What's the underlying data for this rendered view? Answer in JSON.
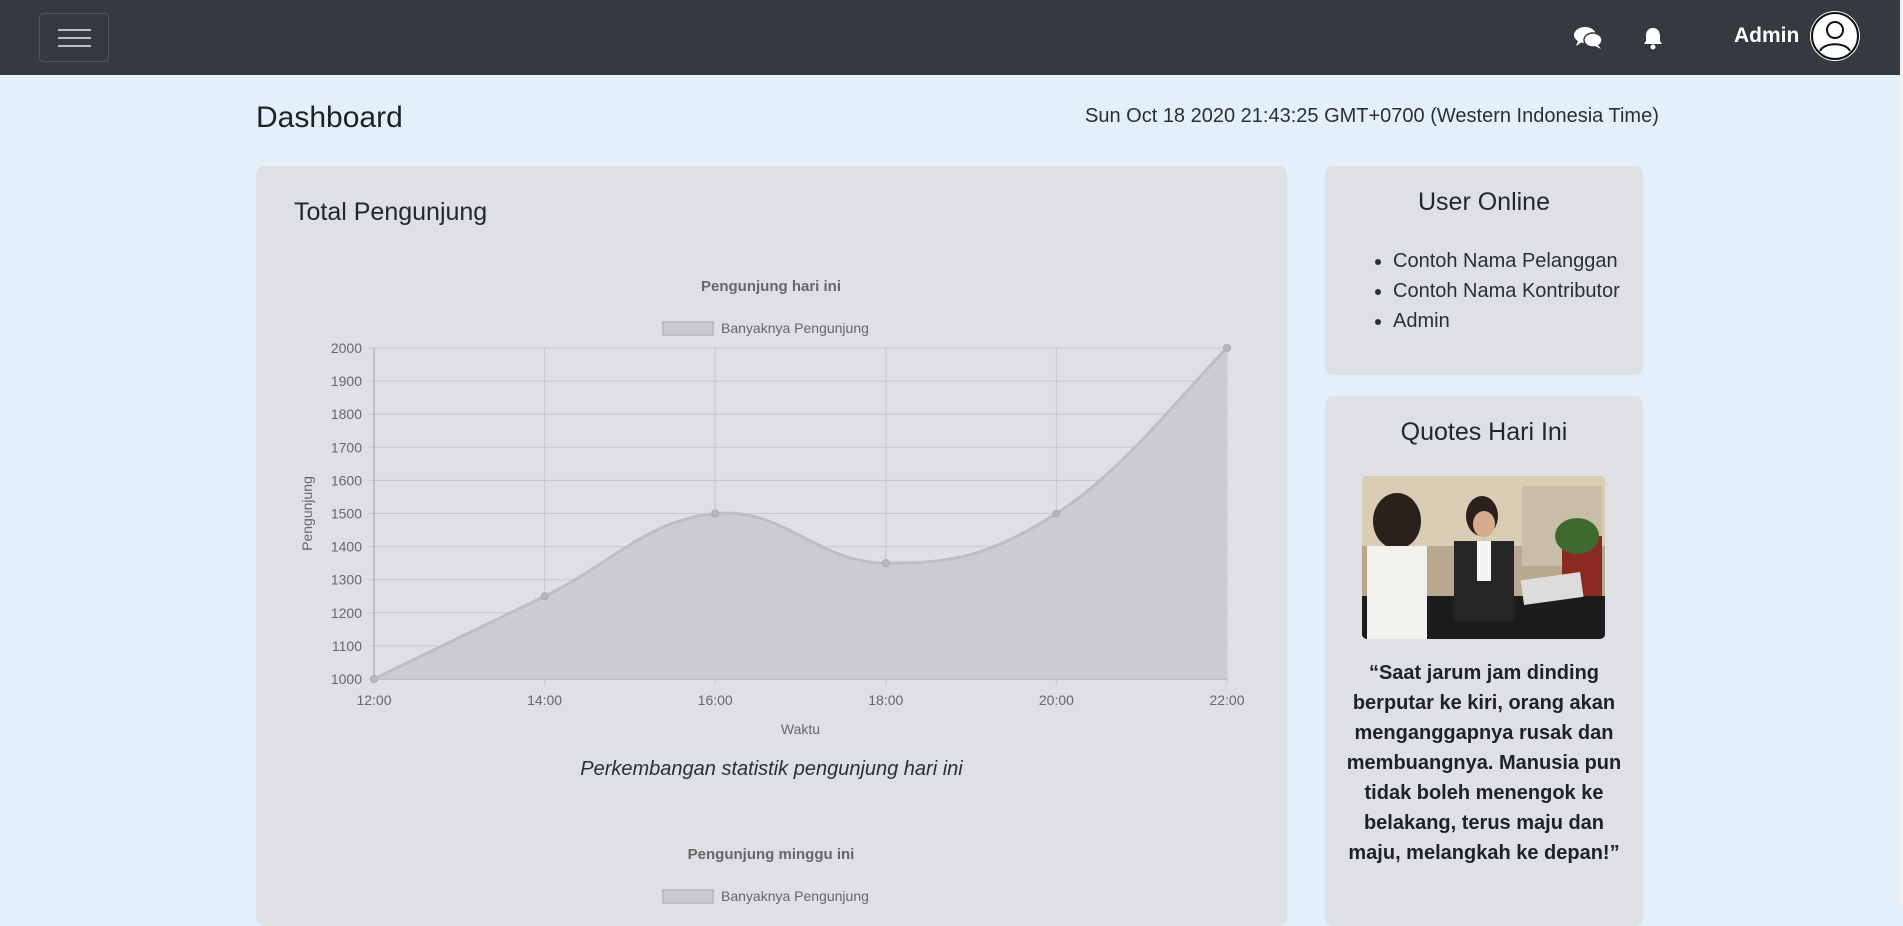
{
  "navbar": {
    "menu_icon": "hamburger-icon",
    "chat_icon": "chat-icon",
    "bell_icon": "bell-icon",
    "user_name": "Admin",
    "avatar_icon": "user-circle-icon",
    "background": "#343a40"
  },
  "header": {
    "title": "Dashboard",
    "datetime": "Sun Oct 18 2020 21:43:25 GMT+0700 (Western Indonesia Time)"
  },
  "main": {
    "title": "Total Pengunjung",
    "caption": "Perkembangan statistik pengunjung hari ini",
    "second_chart_title": "Pengunjung minggu ini",
    "second_chart_legend": "Banyaknya Pengunjung"
  },
  "users_online": {
    "title": "User Online",
    "items": [
      "Contoh Nama Pelanggan",
      "Contoh Nama Kontributor",
      "Admin"
    ]
  },
  "quotes": {
    "title": "Quotes Hari Ini",
    "text": "“Saat jarum jam dinding berputar ke kiri, orang akan menganggapnya rusak dan membuangnya. Manusia pun tidak boleh menengok ke belakang, terus maju dan maju, melangkah ke depan!”"
  },
  "chart_data": [
    {
      "type": "area",
      "title": "Pengunjung hari ini",
      "xlabel": "Waktu",
      "ylabel": "Pengunjung",
      "categories": [
        "12:00",
        "14:00",
        "16:00",
        "18:00",
        "20:00",
        "22:00"
      ],
      "series": [
        {
          "name": "Banyaknya Pengunjung",
          "values": [
            1000,
            1250,
            1500,
            1350,
            1500,
            2000
          ]
        }
      ],
      "ylim": [
        1000,
        2000
      ],
      "yticks": [
        1000,
        1100,
        1200,
        1300,
        1400,
        1500,
        1600,
        1700,
        1800,
        1900,
        2000
      ],
      "grid": true,
      "legend": "top-center",
      "fill_color": "#c8cacd",
      "line_color": "#bcbec1"
    }
  ]
}
